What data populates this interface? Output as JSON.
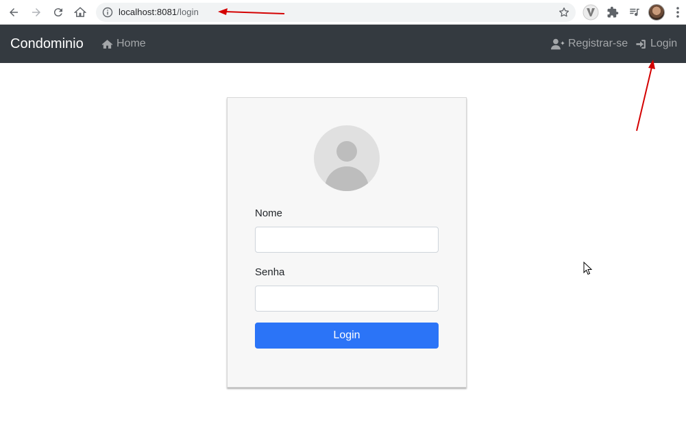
{
  "browser": {
    "url_host": "localhost:8081",
    "url_path": "/login",
    "icons": [
      "back-icon",
      "forward-icon",
      "reload-icon",
      "home-icon",
      "info-icon",
      "star-icon",
      "extension-v-icon",
      "puzzle-icon",
      "media-queue-icon",
      "profile-avatar",
      "menu-dots-icon"
    ]
  },
  "navbar": {
    "brand": "Condominio",
    "home_label": "Home",
    "register_label": "Registrar-se",
    "login_label": "Login"
  },
  "login_form": {
    "name_label": "Nome",
    "name_value": "",
    "password_label": "Senha",
    "password_value": "",
    "submit_label": "Login"
  },
  "colors": {
    "navbar_bg": "#343a40",
    "primary_button": "#2b74f7",
    "card_bg": "#f7f7f7",
    "annotation_arrow": "#d40000"
  }
}
